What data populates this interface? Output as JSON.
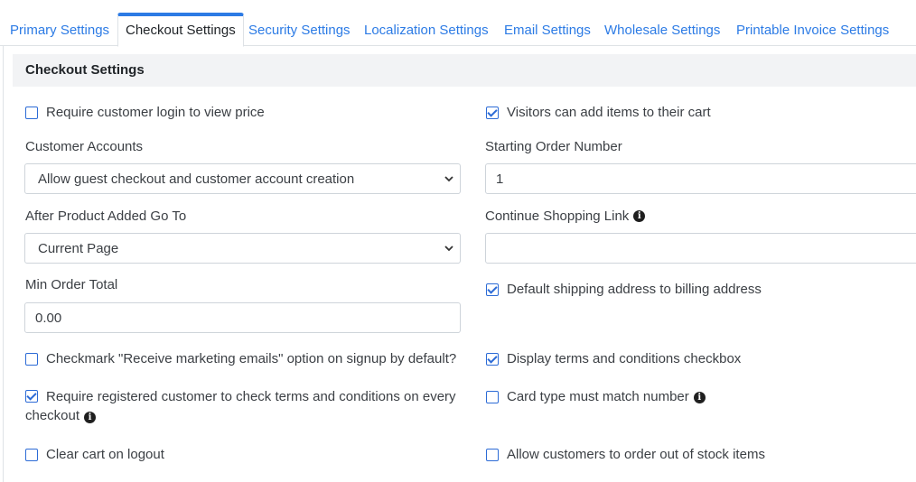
{
  "tabs": [
    {
      "label": "Primary Settings",
      "active": false
    },
    {
      "label": "Checkout Settings",
      "active": true
    },
    {
      "label": "Security Settings",
      "active": false
    },
    {
      "label": "Localization Settings",
      "active": false
    },
    {
      "label": "Email Settings",
      "active": false
    },
    {
      "label": "Wholesale Settings",
      "active": false
    },
    {
      "label": "Printable Invoice Settings",
      "active": false
    }
  ],
  "section_title": "Checkout Settings",
  "left": {
    "require_login": {
      "label": "Require customer login to view price",
      "checked": false
    },
    "customer_accounts": {
      "label": "Customer Accounts",
      "value": "Allow guest checkout and customer account creation"
    },
    "after_product_added": {
      "label": "After Product Added Go To",
      "value": "Current Page"
    },
    "min_order_total": {
      "label": "Min Order Total",
      "value": "0.00"
    },
    "marketing_default": {
      "label": "Checkmark \"Receive marketing emails\" option on signup by default?",
      "checked": false
    },
    "require_terms": {
      "label_line1": "Require registered customer to check terms and conditions on every",
      "label_line2": "checkout",
      "checked": true
    },
    "clear_cart": {
      "label": "Clear cart on logout",
      "checked": false
    }
  },
  "right": {
    "visitors_add": {
      "label": "Visitors can add items to their cart",
      "checked": true
    },
    "starting_order": {
      "label": "Starting Order Number",
      "value": "1"
    },
    "continue_shopping": {
      "label": "Continue Shopping Link",
      "value": ""
    },
    "default_shipping": {
      "label": "Default shipping address to billing address",
      "checked": true
    },
    "display_terms": {
      "label": "Display terms and conditions checkbox",
      "checked": true
    },
    "card_type": {
      "label": "Card type must match number",
      "checked": false
    },
    "out_of_stock": {
      "label": "Allow customers to order out of stock items",
      "checked": false
    }
  },
  "icons": {
    "info": "info-circle-icon",
    "chevron": "chevron-down-icon"
  },
  "colors": {
    "accent": "#2c7be5",
    "header_bg": "#f2f3f5"
  }
}
